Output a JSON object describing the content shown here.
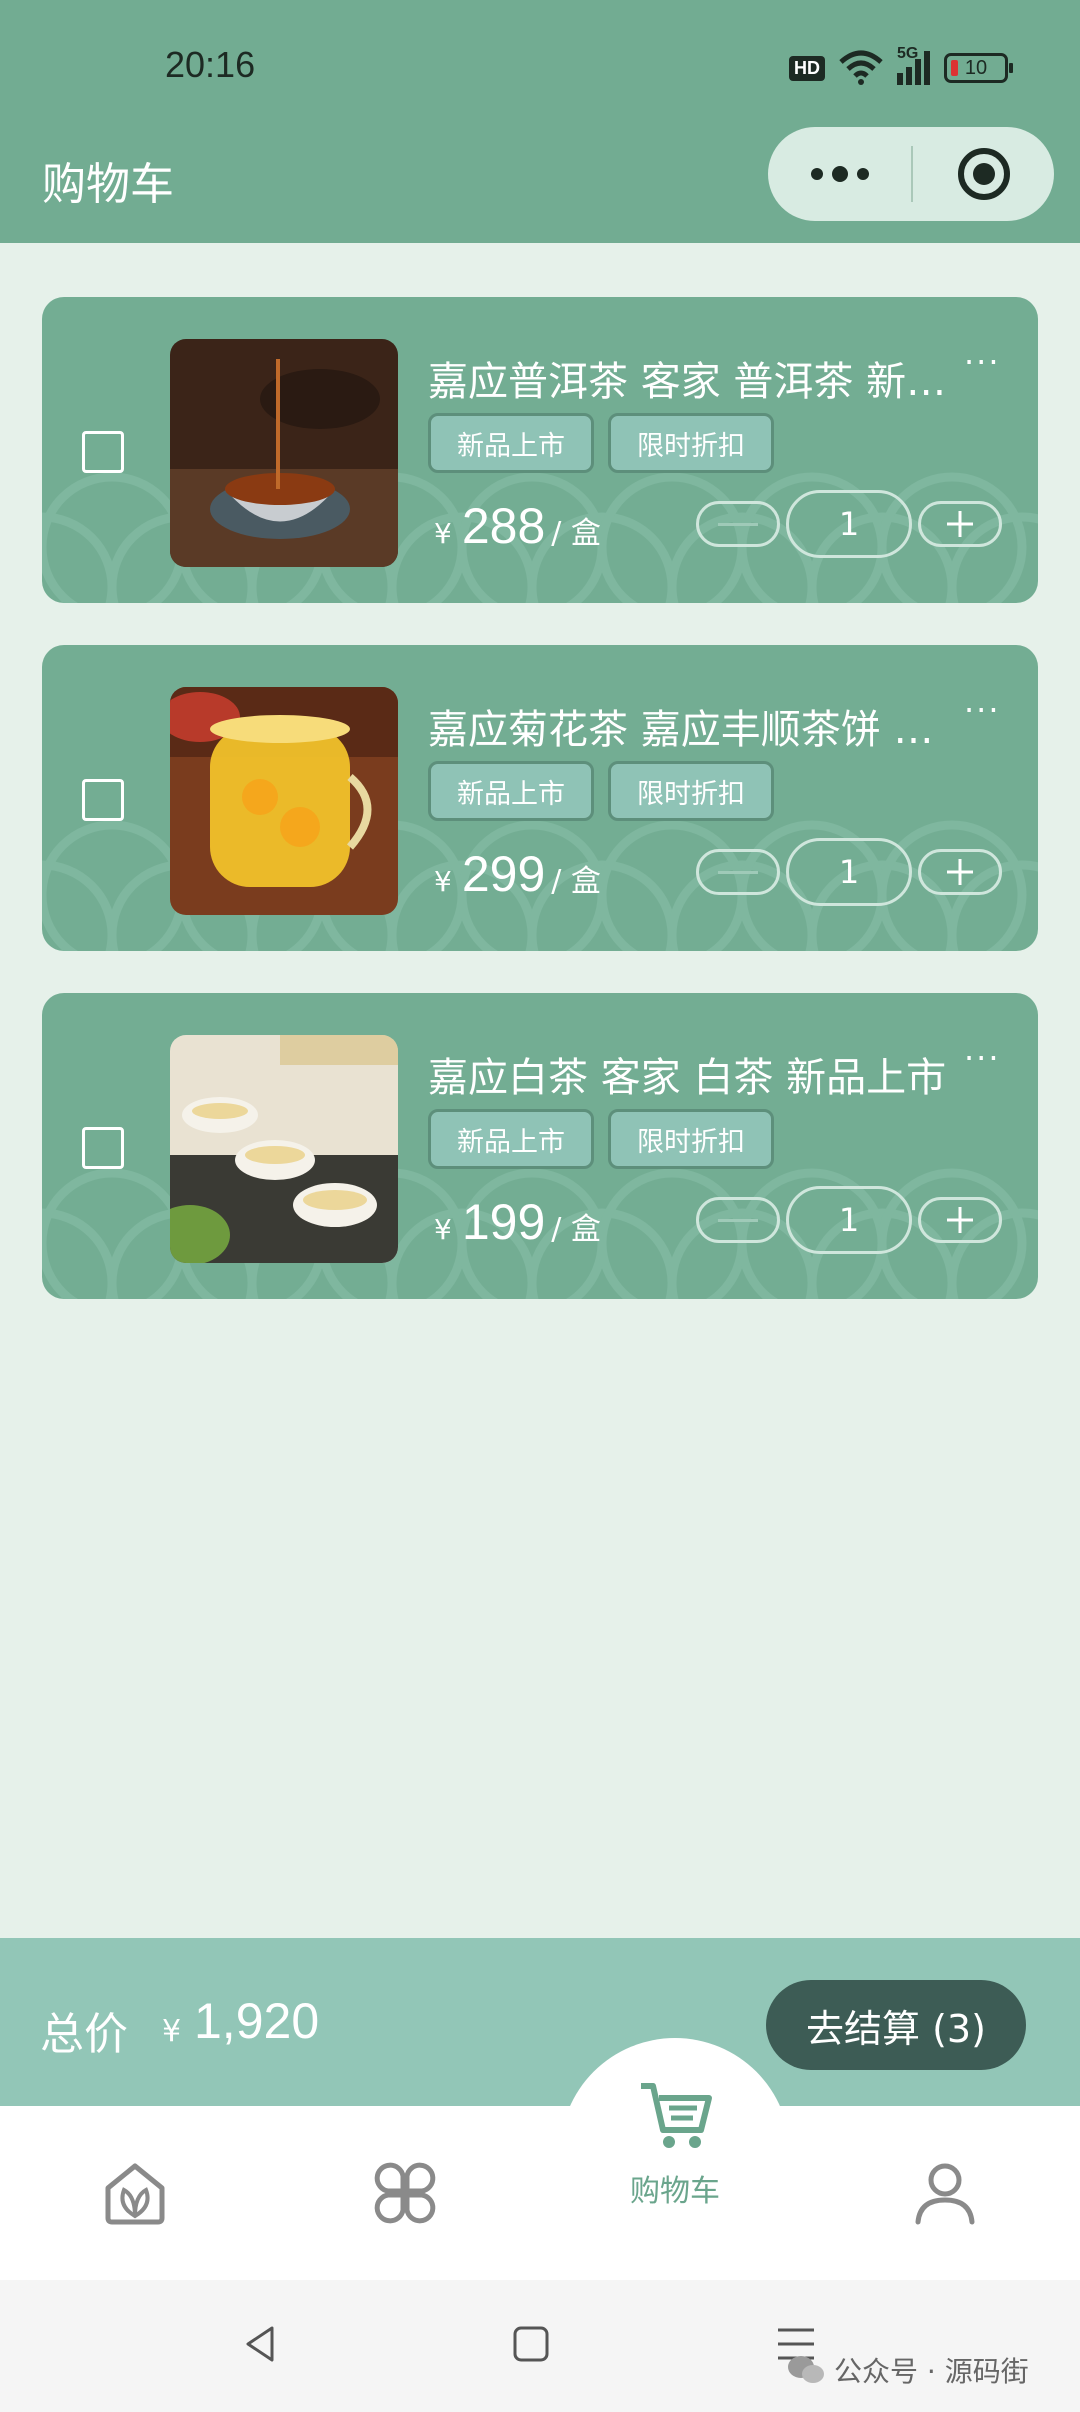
{
  "status_bar": {
    "time": "20:16",
    "hd": "HD",
    "network": "5G",
    "battery": "10"
  },
  "header": {
    "title": "购物车"
  },
  "cart": {
    "items": [
      {
        "name": "嘉应普洱茶 客家 普洱茶 新品上市",
        "tags": [
          "新品上市",
          "限时折扣"
        ],
        "currency": "¥",
        "price": "288",
        "unit": "/ 盒",
        "quantity": "1",
        "more": "···"
      },
      {
        "name": "嘉应菊花茶 嘉应丰顺茶饼 新品上市",
        "tags": [
          "新品上市",
          "限时折扣"
        ],
        "currency": "¥",
        "price": "299",
        "unit": "/ 盒",
        "quantity": "1",
        "more": "···"
      },
      {
        "name": "嘉应白茶 客家 白茶 新品上市",
        "tags": [
          "新品上市",
          "限时折扣"
        ],
        "currency": "¥",
        "price": "199",
        "unit": "/ 盒",
        "quantity": "1",
        "more": "···"
      }
    ]
  },
  "summary": {
    "total_label": "总价",
    "currency": "¥",
    "total": "1,920",
    "checkout_label": "去结算 (3)"
  },
  "tabbar": {
    "cart_label": "购物车"
  },
  "watermark": "公众号 · 源码街",
  "colors": {
    "header": "#72ac92",
    "card": "#73ad93",
    "checkout": "#3d5c55",
    "accent": "#6aa58c"
  }
}
